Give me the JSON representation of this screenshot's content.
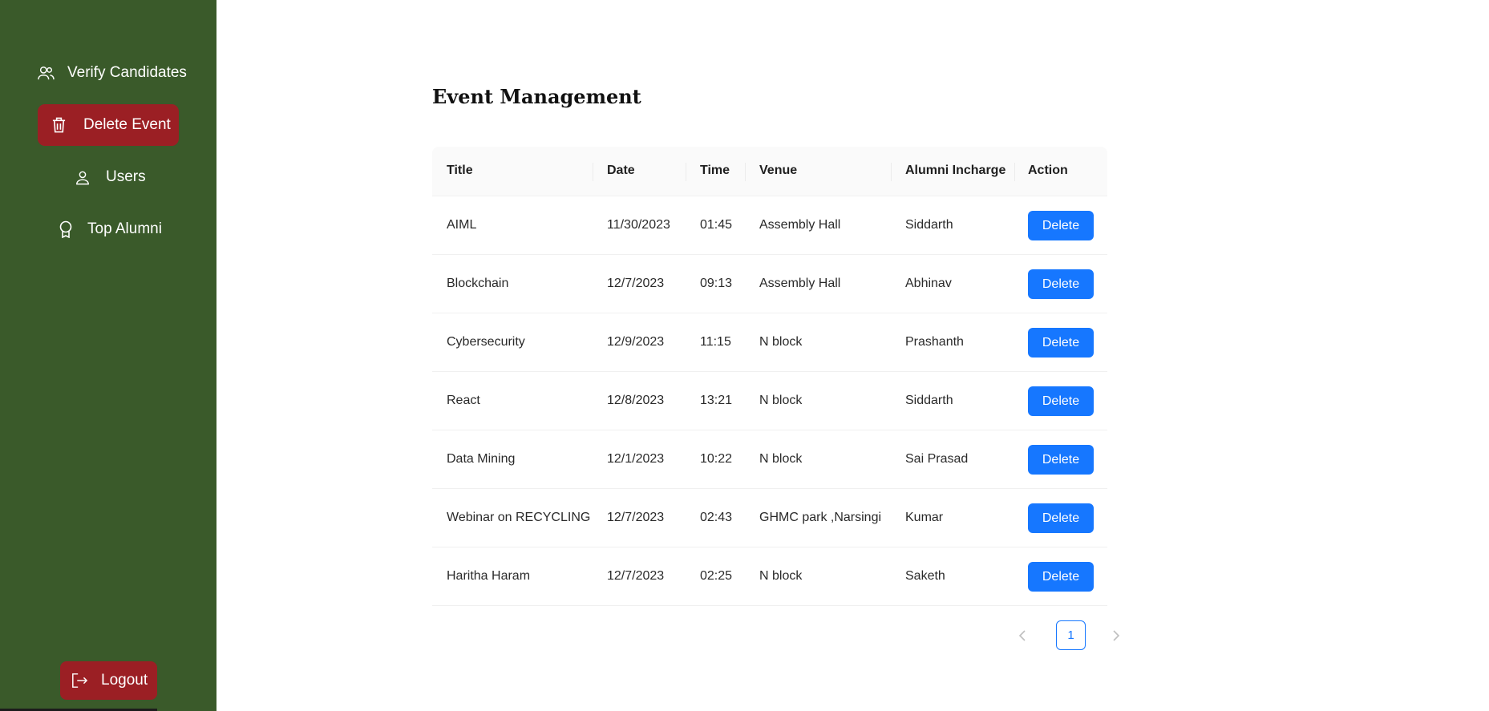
{
  "sidebar": {
    "items": [
      {
        "label": "Verify Candidates",
        "icon": "users-icon"
      },
      {
        "label": "Delete Event",
        "icon": "trash-icon",
        "active": true
      },
      {
        "label": "Users",
        "icon": "user-icon"
      },
      {
        "label": "Top Alumni",
        "icon": "award-icon"
      }
    ],
    "logout_label": "Logout"
  },
  "main": {
    "title": "Event Management",
    "table": {
      "headers": [
        "Title",
        "Date",
        "Time",
        "Venue",
        "Alumni Incharge",
        "Action"
      ],
      "rows": [
        {
          "title": "AIML",
          "date": "11/30/2023",
          "time": "01:45",
          "venue": "Assembly Hall",
          "alumni": "Siddarth",
          "action": "Delete"
        },
        {
          "title": "Blockchain",
          "date": "12/7/2023",
          "time": "09:13",
          "venue": "Assembly Hall",
          "alumni": "Abhinav",
          "action": "Delete"
        },
        {
          "title": "Cybersecurity",
          "date": "12/9/2023",
          "time": "11:15",
          "venue": "N block",
          "alumni": "Prashanth",
          "action": "Delete"
        },
        {
          "title": "React",
          "date": "12/8/2023",
          "time": "13:21",
          "venue": "N block",
          "alumni": "Siddarth",
          "action": "Delete"
        },
        {
          "title": "Data Mining",
          "date": "12/1/2023",
          "time": "10:22",
          "venue": "N block",
          "alumni": "Sai Prasad",
          "action": "Delete"
        },
        {
          "title": "Webinar on RECYCLING",
          "date": "12/7/2023",
          "time": "02:43",
          "venue": "GHMC park ,Narsingi",
          "alumni": "Kumar",
          "action": "Delete"
        },
        {
          "title": "Haritha Haram",
          "date": "12/7/2023",
          "time": "02:25",
          "venue": "N block",
          "alumni": "Saketh",
          "action": "Delete"
        }
      ]
    },
    "pagination": {
      "current_page": "1",
      "prev_icon": "chevron-left-icon",
      "next_icon": "chevron-right-icon"
    }
  },
  "colors": {
    "sidebar_bg": "#3a5a2a",
    "active_item_bg": "#9b1f24",
    "primary": "#1677ff"
  }
}
